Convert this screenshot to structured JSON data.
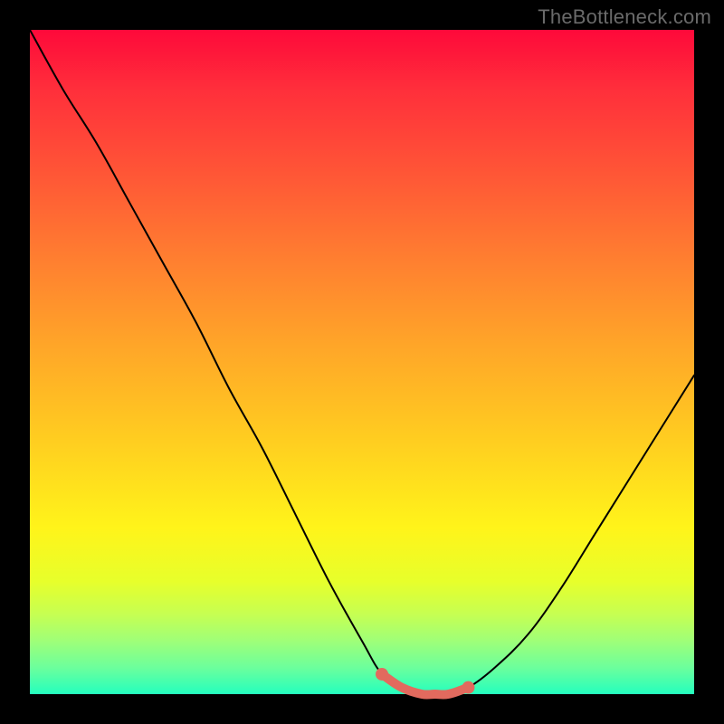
{
  "watermark": "TheBottleneck.com",
  "colors": {
    "frame": "#000000",
    "curve_stroke": "#000000",
    "highlight_stroke": "#e26a5e",
    "highlight_fill": "#e26a5e",
    "gradient_top": "#fe093a",
    "gradient_bottom": "#24ffbe",
    "watermark": "#6a6a6a"
  },
  "chart_data": {
    "type": "line",
    "title": "",
    "xlabel": "",
    "ylabel": "",
    "xlim": [
      0,
      100
    ],
    "ylim": [
      0,
      100
    ],
    "grid": false,
    "legend": false,
    "x": [
      0,
      5,
      10,
      15,
      20,
      25,
      30,
      35,
      40,
      45,
      50,
      53,
      56,
      59,
      61,
      63,
      66,
      70,
      75,
      80,
      85,
      90,
      95,
      100
    ],
    "values": [
      100,
      91,
      83,
      74,
      65,
      56,
      46,
      37,
      27,
      17,
      8,
      3,
      1,
      0,
      0,
      0,
      1,
      4,
      9,
      16,
      24,
      32,
      40,
      48
    ],
    "highlight_region": {
      "x_start": 53,
      "x_end": 66
    },
    "note": "x and values are estimated from pixel positions; y=0 is the chart bottom (green), y=100 is the top (red). The curve descends steeply from top-left, flattens near the bottom around x≈53–66 where a salmon-colored highlight segment with endpoint dots is drawn, then rises toward the right edge reaching roughly 48% height."
  }
}
